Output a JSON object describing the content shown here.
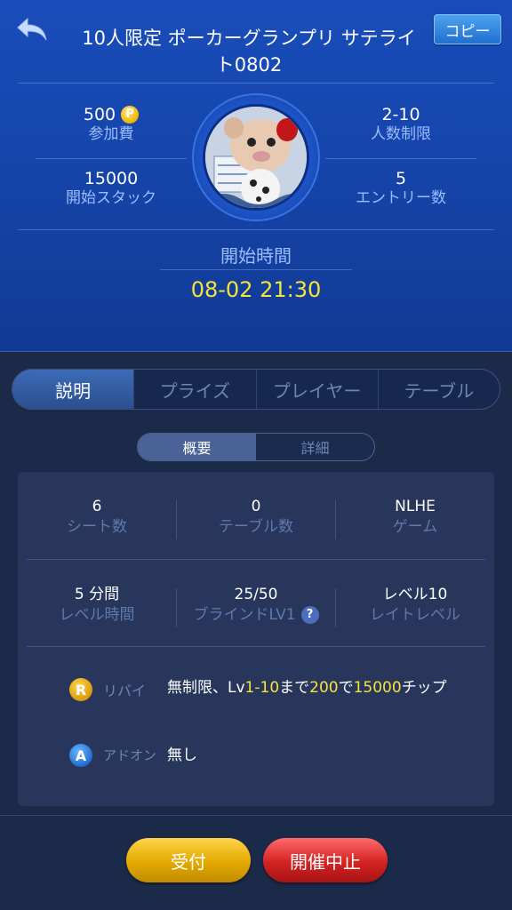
{
  "header": {
    "title": "10人限定 ポーカーグランプリ サテライト0802",
    "copy_label": "コピー",
    "entry_fee": {
      "value": "500",
      "label": "参加費"
    },
    "player_limit": {
      "value": "2-10",
      "label": "人数制限"
    },
    "start_stack": {
      "value": "15000",
      "label": "開始スタック"
    },
    "entries": {
      "value": "5",
      "label": "エントリー数"
    },
    "start_label": "開始時間",
    "start_time": "08-02 21:30"
  },
  "tabs": [
    "説明",
    "プライズ",
    "プレイヤー",
    "テーブル"
  ],
  "subtabs": [
    "概要",
    "詳細"
  ],
  "overview": {
    "seats": {
      "value": "6",
      "label": "シート数"
    },
    "tables": {
      "value": "0",
      "label": "テーブル数"
    },
    "game": {
      "value": "NLHE",
      "label": "ゲーム"
    },
    "level_time": {
      "value": "5 分間",
      "label": "レベル時間"
    },
    "blind": {
      "value": "25/50",
      "label": "ブラインドLV1"
    },
    "late_level": {
      "value": "レベル10",
      "label": "レイトレベル"
    }
  },
  "rules": {
    "rebuy": {
      "badge": "R",
      "label": "リバイ",
      "t1": "無制限、Lv",
      "h1": "1-10",
      "t2": "まで",
      "h2": "200",
      "t3": "で",
      "h3": "15000",
      "t4": "チップ"
    },
    "addon": {
      "badge": "A",
      "label": "アドオン",
      "text": "無し"
    }
  },
  "buttons": {
    "accept": "受付",
    "cancel": "開催中止"
  },
  "colors": {
    "accent_yellow": "#f7e43a",
    "header_blue": "#1646ad",
    "label_blue": "#9bbcff"
  }
}
